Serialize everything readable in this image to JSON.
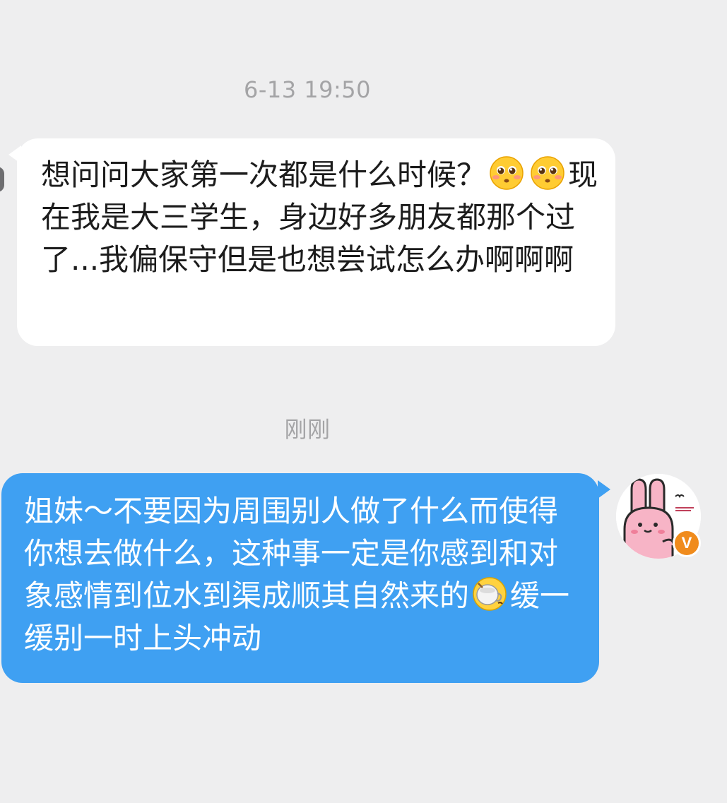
{
  "conversation": {
    "timestamp_first": "6-13 19:50",
    "timestamp_second": "刚刚",
    "received_message": {
      "text_part1": "想问问大家第一次都是什么时候？",
      "emoji_1": "pleading-face-emoji",
      "emoji_2": "pleading-face-emoji",
      "text_part2": "现在我是大三学生，身边好多朋友都那个过了...我偏保守但是也想尝试怎么办啊啊啊"
    },
    "sent_message": {
      "text_part1": "姐妹～不要因为周围别人做了什么而使得你想去做什么，这种事一定是你感到和对象感情到位水到渠成顺其自然来的",
      "emoji": "tea-cup-emoji",
      "text_part2": "缓一缓别一时上头冲动"
    },
    "sender_avatar": {
      "icon": "pink-bunny-avatar",
      "verified_badge": "V",
      "badge_color": "#f08b1c"
    }
  },
  "colors": {
    "background": "#eeeeef",
    "received_bubble": "#ffffff",
    "sent_bubble": "#3fa0f2",
    "timestamp": "#a4a4a6"
  }
}
